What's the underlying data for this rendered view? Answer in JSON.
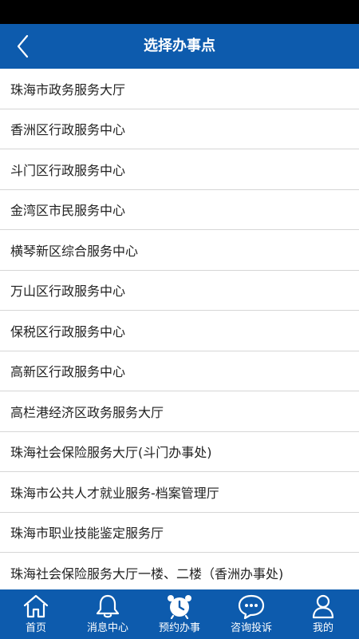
{
  "header": {
    "title": "选择办事点",
    "background": "#0d5bad"
  },
  "list": {
    "items": [
      {
        "label": "珠海市政务服务大厅"
      },
      {
        "label": "香洲区行政服务中心"
      },
      {
        "label": "斗门区行政服务中心"
      },
      {
        "label": "金湾区市民服务中心"
      },
      {
        "label": "横琴新区综合服务中心"
      },
      {
        "label": "万山区行政服务中心"
      },
      {
        "label": "保税区行政服务中心"
      },
      {
        "label": "高新区行政服务中心"
      },
      {
        "label": "高栏港经济区政务服务大厅"
      },
      {
        "label": "珠海社会保险服务大厅(斗门办事处)"
      },
      {
        "label": "珠海市公共人才就业服务-档案管理厅"
      },
      {
        "label": "珠海市职业技能鉴定服务厅"
      },
      {
        "label": "珠海社会保险服务大厅一楼、二楼（香洲办事处)"
      }
    ]
  },
  "tabbar": {
    "tabs": [
      {
        "label": "首页",
        "icon": "home-icon"
      },
      {
        "label": "消息中心",
        "icon": "bell-icon"
      },
      {
        "label": "预约办事",
        "icon": "alarm-clock-icon"
      },
      {
        "label": "咨询投诉",
        "icon": "chat-bubble-icon"
      },
      {
        "label": "我的",
        "icon": "user-icon"
      }
    ]
  }
}
